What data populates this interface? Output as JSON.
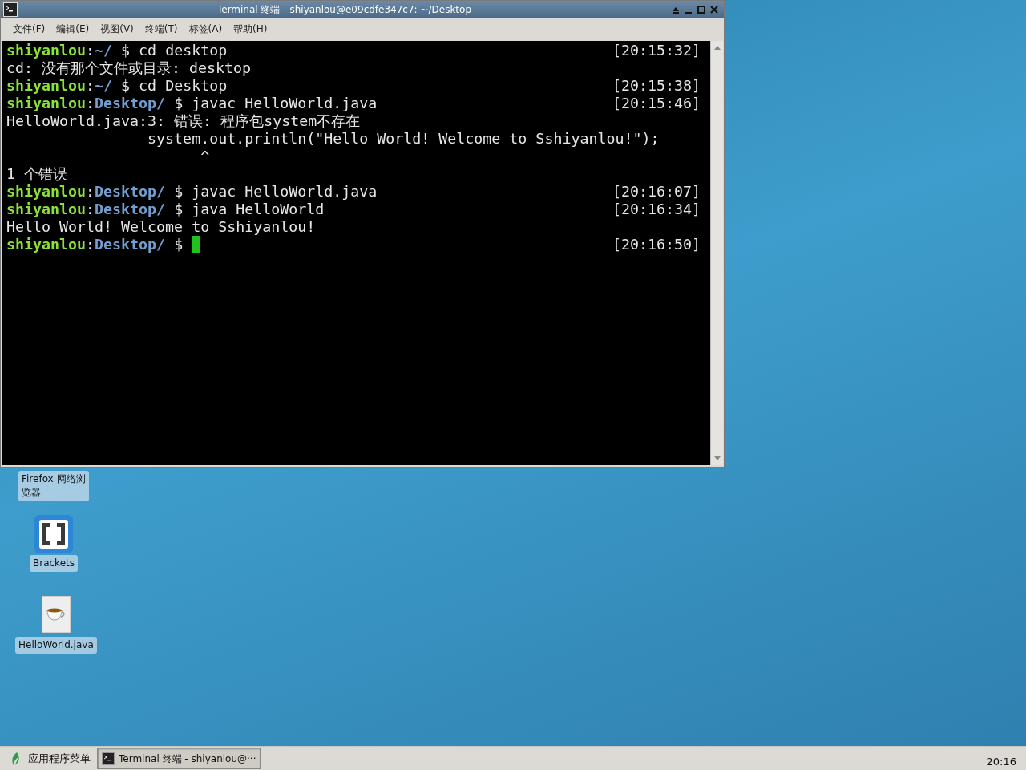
{
  "window": {
    "title": "Terminal 终端 - shiyanlou@e09cdfe347c7: ~/Desktop",
    "menu": [
      "文件(F)",
      "编辑(E)",
      "视图(V)",
      "终端(T)",
      "标签(A)",
      "帮助(H)"
    ],
    "lines": [
      {
        "kind": "prompt",
        "user": "shiyanlou",
        "separator": ":",
        "path": "~/",
        "command": "$ cd desktop",
        "time": "[20:15:32]"
      },
      {
        "kind": "output",
        "text": "cd: 没有那个文件或目录: desktop"
      },
      {
        "kind": "prompt",
        "user": "shiyanlou",
        "separator": ":",
        "path": "~/",
        "command": "$ cd Desktop",
        "time": "[20:15:38]"
      },
      {
        "kind": "prompt",
        "user": "shiyanlou",
        "separator": ":",
        "path": "Desktop/",
        "command": "$ javac HelloWorld.java",
        "time": "[20:15:46]"
      },
      {
        "kind": "output",
        "text": "HelloWorld.java:3: 错误: 程序包system不存在"
      },
      {
        "kind": "output",
        "text": "                system.out.println(\"Hello World! Welcome to Sshiyanlou!\");"
      },
      {
        "kind": "output",
        "text": "                      ^"
      },
      {
        "kind": "output",
        "text": "1 个错误"
      },
      {
        "kind": "prompt",
        "user": "shiyanlou",
        "separator": ":",
        "path": "Desktop/",
        "command": "$ javac HelloWorld.java",
        "time": "[20:16:07]"
      },
      {
        "kind": "prompt",
        "user": "shiyanlou",
        "separator": ":",
        "path": "Desktop/",
        "command": "$ java HelloWorld",
        "time": "[20:16:34]"
      },
      {
        "kind": "output",
        "text": "Hello World! Welcome to Sshiyanlou!"
      },
      {
        "kind": "prompt",
        "user": "shiyanlou",
        "separator": ":",
        "path": "Desktop/",
        "command": "$",
        "time": "[20:16:50]",
        "cursor": true
      }
    ]
  },
  "desktop_icons": [
    {
      "kind": "label_only",
      "label": "Firefox 网络浏览器"
    },
    {
      "kind": "brackets",
      "label": "Brackets"
    },
    {
      "kind": "java_file",
      "label": "HelloWorld.java"
    }
  ],
  "taskbar": {
    "menu_label": "应用程序菜单",
    "tasks": [
      {
        "label": "Terminal 终端 - shiyanlou@···",
        "selected": true
      }
    ],
    "clock": "20:16"
  }
}
